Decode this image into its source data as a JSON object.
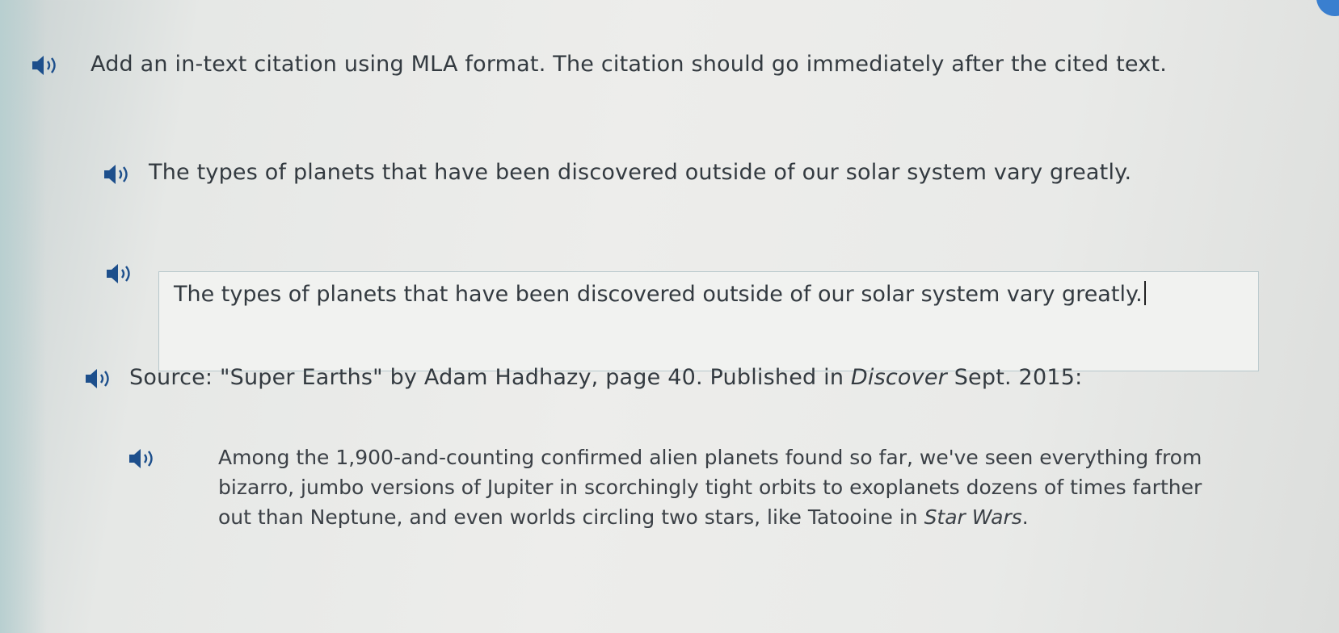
{
  "instruction": {
    "text": "Add an in-text citation using MLA format. The citation should go immediately after the cited text."
  },
  "prompt_sentence": {
    "text": "The types of planets that have been discovered outside of our solar system vary greatly."
  },
  "answer_field": {
    "value": "The types of planets that have been discovered outside of our solar system vary greatly."
  },
  "source": {
    "prefix": "Source: \"Super Earths\" by Adam Hadhazy, page 40. Published in ",
    "publication": "Discover",
    "suffix": " Sept. 2015:"
  },
  "excerpt": {
    "main": "Among the 1,900-and-counting confirmed alien planets found so far, we've seen everything from bizarro, jumbo versions of Jupiter in scorchingly tight orbits to exoplanets dozens of times farther out than Neptune, and even worlds circling two stars, like Tatooine in ",
    "title": "Star Wars",
    "end": "."
  },
  "icons": {
    "audio": "speaker-icon"
  },
  "colors": {
    "speaker": "#1d4f8c",
    "badge": "#3a7fcf"
  }
}
